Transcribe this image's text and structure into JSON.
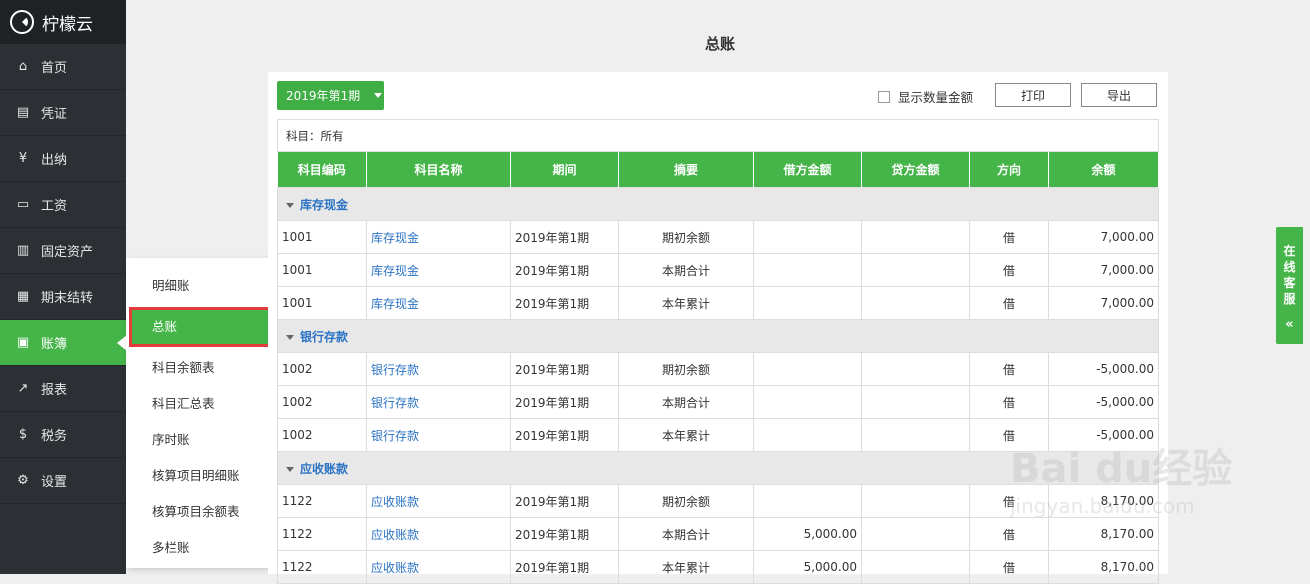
{
  "app": {
    "name": "柠檬云"
  },
  "nav": [
    {
      "label": "首页",
      "icon": "home-icon"
    },
    {
      "label": "凭证",
      "icon": "voucher-icon"
    },
    {
      "label": "出纳",
      "icon": "cashier-icon"
    },
    {
      "label": "工资",
      "icon": "salary-icon"
    },
    {
      "label": "固定资产",
      "icon": "assets-icon"
    },
    {
      "label": "期末结转",
      "icon": "calendar-icon"
    },
    {
      "label": "账簿",
      "icon": "book-icon",
      "active": true
    },
    {
      "label": "报表",
      "icon": "chart-icon"
    },
    {
      "label": "税务",
      "icon": "tax-icon"
    },
    {
      "label": "设置",
      "icon": "gear-icon"
    }
  ],
  "submenu": [
    "明细账",
    "总账",
    "科目余额表",
    "科目汇总表",
    "序时账",
    "核算项目明细账",
    "核算项目余额表",
    "多栏账"
  ],
  "page": {
    "title": "总账",
    "period": "2019年第1期",
    "qty_label": "显示数量金额",
    "print": "打印",
    "export": "导出",
    "filter": "科目：所有"
  },
  "table": {
    "headers": [
      "科目编码",
      "科目名称",
      "期间",
      "摘要",
      "借方金额",
      "贷方金额",
      "方向",
      "余额"
    ],
    "groups": [
      {
        "name": "库存现金",
        "rows": [
          [
            "1001",
            "库存现金",
            "2019年第1期",
            "期初余额",
            "",
            "",
            "借",
            "7,000.00"
          ],
          [
            "1001",
            "库存现金",
            "2019年第1期",
            "本期合计",
            "",
            "",
            "借",
            "7,000.00"
          ],
          [
            "1001",
            "库存现金",
            "2019年第1期",
            "本年累计",
            "",
            "",
            "借",
            "7,000.00"
          ]
        ]
      },
      {
        "name": "银行存款",
        "rows": [
          [
            "1002",
            "银行存款",
            "2019年第1期",
            "期初余额",
            "",
            "",
            "借",
            "-5,000.00"
          ],
          [
            "1002",
            "银行存款",
            "2019年第1期",
            "本期合计",
            "",
            "",
            "借",
            "-5,000.00"
          ],
          [
            "1002",
            "银行存款",
            "2019年第1期",
            "本年累计",
            "",
            "",
            "借",
            "-5,000.00"
          ]
        ]
      },
      {
        "name": "应收账款",
        "rows": [
          [
            "1122",
            "应收账款",
            "2019年第1期",
            "期初余额",
            "",
            "",
            "借",
            "8,170.00"
          ],
          [
            "1122",
            "应收账款",
            "2019年第1期",
            "本期合计",
            "5,000.00",
            "",
            "借",
            "8,170.00"
          ],
          [
            "1122",
            "应收账款",
            "2019年第1期",
            "本年累计",
            "5,000.00",
            "",
            "借",
            "8,170.00"
          ]
        ]
      }
    ]
  },
  "service": {
    "label": "在线客服",
    "chevron": "«"
  },
  "watermark": {
    "main": "Bai du经验",
    "sub": "jingyan.baidu.com"
  }
}
